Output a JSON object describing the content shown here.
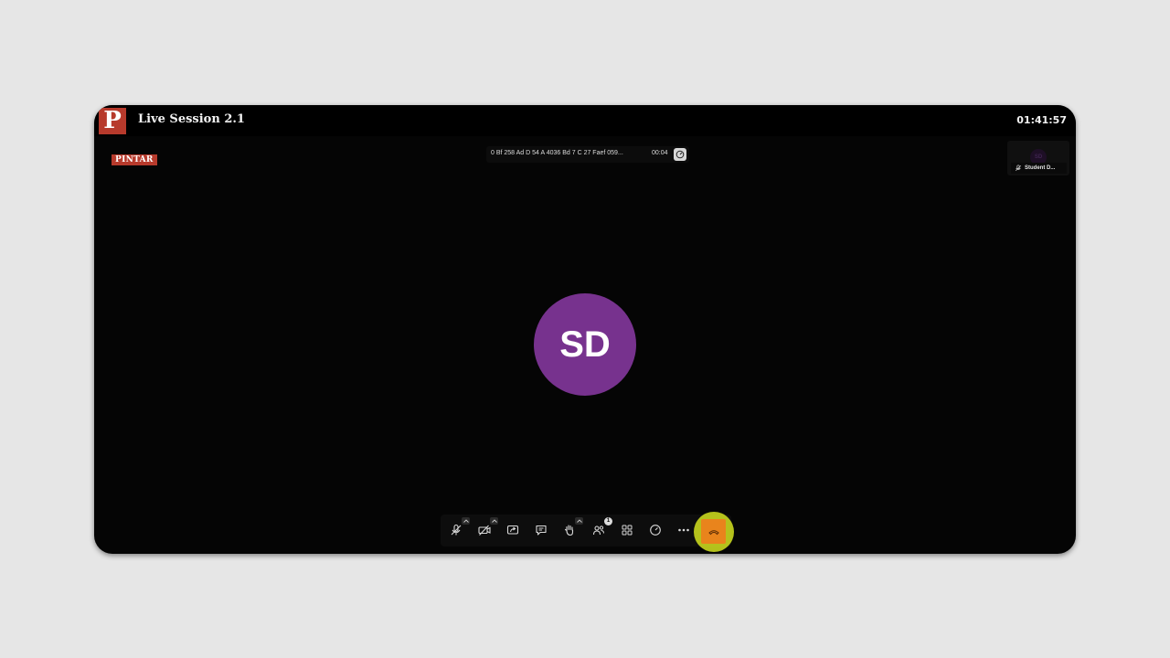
{
  "app": {
    "logo_letter": "P",
    "title": "Live Session 2.1",
    "clock": "01:41:57",
    "brand_badge": "PINTAR"
  },
  "meeting": {
    "id_text": "0 Bf 258 Ad D 54 A 4036 Bd 7 C 27 Faef 059...",
    "elapsed": "00:04"
  },
  "self_view": {
    "initials": "SD",
    "name": "Student D..."
  },
  "main_participant": {
    "initials": "SD",
    "avatar_color": "#77328e"
  },
  "toolbar": {
    "buttons": [
      {
        "icon": "mic-off-icon",
        "has_caret": true
      },
      {
        "icon": "camera-off-icon",
        "has_caret": true
      },
      {
        "icon": "share-screen-icon",
        "has_caret": false
      },
      {
        "icon": "chat-icon",
        "has_caret": false
      },
      {
        "icon": "raise-hand-icon",
        "has_caret": true
      },
      {
        "icon": "participants-icon",
        "has_caret": false
      },
      {
        "icon": "grid-view-icon",
        "has_caret": false
      },
      {
        "icon": "speed-test-icon",
        "has_caret": false
      },
      {
        "icon": "more-icon",
        "has_caret": false
      },
      {
        "icon": "leave-call-icon",
        "has_caret": false
      }
    ],
    "participant_count": "1",
    "leave_color": "#e9841c",
    "highlight_color": "#c8d61e"
  }
}
